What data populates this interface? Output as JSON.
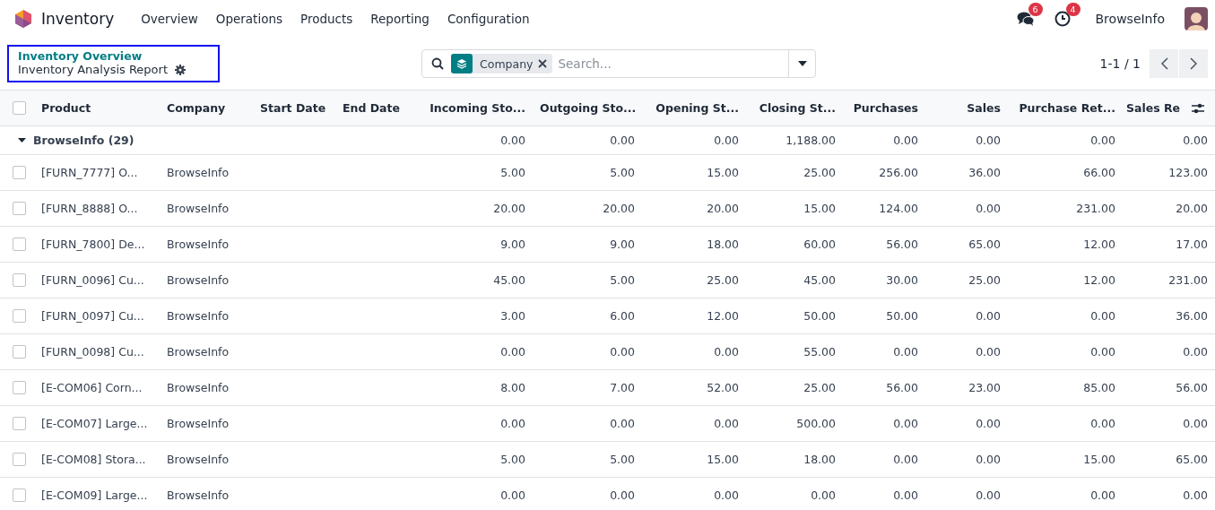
{
  "navbar": {
    "app_name": "Inventory",
    "menu": [
      "Overview",
      "Operations",
      "Products",
      "Reporting",
      "Configuration"
    ],
    "messages_count": "6",
    "activities_count": "4",
    "user": "BrowseInfo"
  },
  "control_panel": {
    "breadcrumb_parent": "Inventory Overview",
    "breadcrumb_current": "Inventory Analysis Report",
    "facet": "Company",
    "search_placeholder": "Search...",
    "pager": "1-1 / 1"
  },
  "table": {
    "select_all_checked": false,
    "columns": [
      {
        "label": "Product",
        "kind": "text"
      },
      {
        "label": "Company",
        "kind": "text"
      },
      {
        "label": "Start Date",
        "kind": "date"
      },
      {
        "label": "End Date",
        "kind": "date"
      },
      {
        "label": "Incoming Sto...",
        "kind": "number"
      },
      {
        "label": "Outgoing Sto...",
        "kind": "number"
      },
      {
        "label": "Opening St...",
        "kind": "number"
      },
      {
        "label": "Closing St...",
        "kind": "number"
      },
      {
        "label": "Purchases",
        "kind": "number"
      },
      {
        "label": "Sales",
        "kind": "number"
      },
      {
        "label": "Purchase Ret...",
        "kind": "number"
      },
      {
        "label": "Sales Re",
        "kind": "number"
      }
    ],
    "group": {
      "label": "BrowseInfo (29)",
      "expanded": true,
      "totals": [
        "0.00",
        "0.00",
        "0.00",
        "1,188.00",
        "0.00",
        "0.00",
        "0.00",
        "0.00"
      ]
    },
    "rows": [
      {
        "product": "[FURN_7777] O...",
        "company": "BrowseInfo",
        "checked": false,
        "values": [
          "5.00",
          "5.00",
          "15.00",
          "25.00",
          "256.00",
          "36.00",
          "66.00",
          "123.00"
        ]
      },
      {
        "product": "[FURN_8888] O...",
        "company": "BrowseInfo",
        "checked": false,
        "values": [
          "20.00",
          "20.00",
          "20.00",
          "15.00",
          "124.00",
          "0.00",
          "231.00",
          "20.00"
        ]
      },
      {
        "product": "[FURN_7800] De...",
        "company": "BrowseInfo",
        "checked": false,
        "values": [
          "9.00",
          "9.00",
          "18.00",
          "60.00",
          "56.00",
          "65.00",
          "12.00",
          "17.00"
        ]
      },
      {
        "product": "[FURN_0096] Cu...",
        "company": "BrowseInfo",
        "checked": false,
        "values": [
          "45.00",
          "5.00",
          "25.00",
          "45.00",
          "30.00",
          "25.00",
          "12.00",
          "231.00"
        ]
      },
      {
        "product": "[FURN_0097] Cu...",
        "company": "BrowseInfo",
        "checked": false,
        "values": [
          "3.00",
          "6.00",
          "12.00",
          "50.00",
          "50.00",
          "0.00",
          "0.00",
          "36.00"
        ]
      },
      {
        "product": "[FURN_0098] Cu...",
        "company": "BrowseInfo",
        "checked": false,
        "values": [
          "0.00",
          "0.00",
          "0.00",
          "55.00",
          "0.00",
          "0.00",
          "0.00",
          "0.00"
        ]
      },
      {
        "product": "[E-COM06] Corn...",
        "company": "BrowseInfo",
        "checked": false,
        "values": [
          "8.00",
          "7.00",
          "52.00",
          "25.00",
          "56.00",
          "23.00",
          "85.00",
          "56.00"
        ]
      },
      {
        "product": "[E-COM07] Large...",
        "company": "BrowseInfo",
        "checked": false,
        "values": [
          "0.00",
          "0.00",
          "0.00",
          "500.00",
          "0.00",
          "0.00",
          "0.00",
          "0.00"
        ]
      },
      {
        "product": "[E-COM08] Stora...",
        "company": "BrowseInfo",
        "checked": false,
        "values": [
          "5.00",
          "5.00",
          "15.00",
          "18.00",
          "0.00",
          "0.00",
          "15.00",
          "65.00"
        ]
      },
      {
        "product": "[E-COM09] Large...",
        "company": "BrowseInfo",
        "checked": false,
        "values": [
          "0.00",
          "0.00",
          "0.00",
          "0.00",
          "0.00",
          "0.00",
          "0.00",
          "0.00"
        ]
      }
    ]
  }
}
